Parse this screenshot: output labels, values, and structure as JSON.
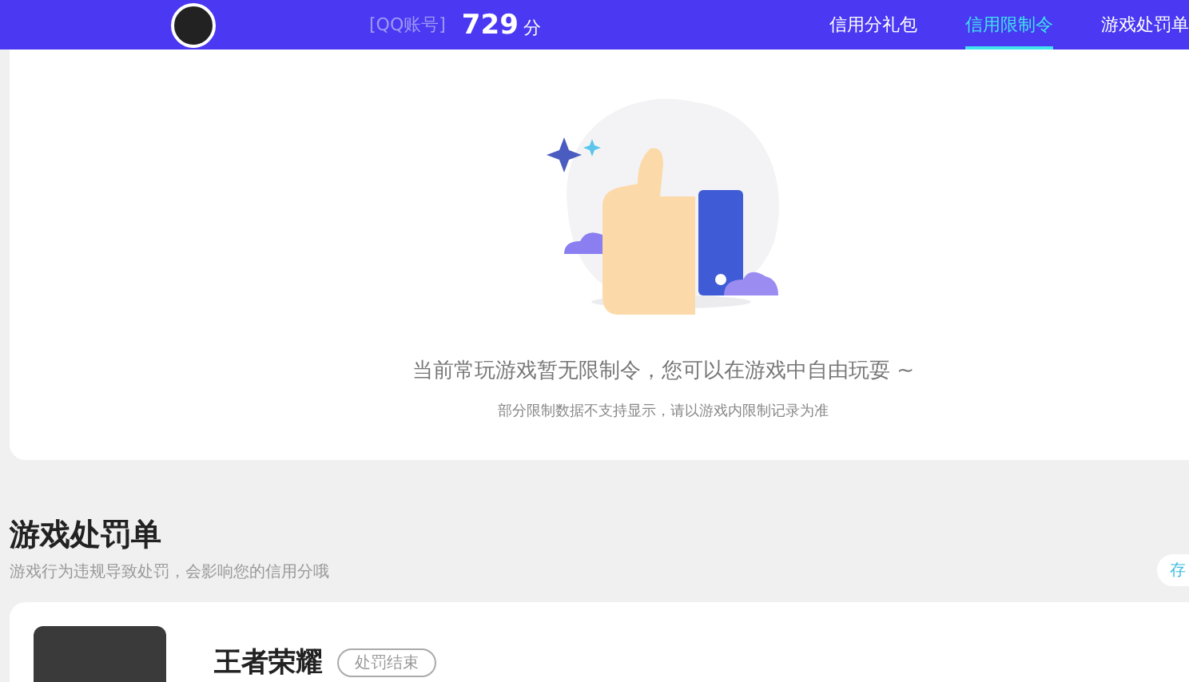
{
  "header": {
    "account_label": "[QQ账号]",
    "score": "729",
    "score_unit": "分",
    "tabs": [
      {
        "label": "信用分礼包",
        "selected": false
      },
      {
        "label": "信用限制令",
        "selected": true
      },
      {
        "label": "游戏处罚单",
        "selected": false
      }
    ]
  },
  "restriction_card": {
    "message": "当前常玩游戏暂无限制令，您可以在游戏中自由玩耍 ~",
    "note": "部分限制数据不支持显示，请以游戏内限制记录为准"
  },
  "penalty_section": {
    "title": "游戏处罚单",
    "subtitle": "游戏行为违规导致处罚，会影响您的信用分哦",
    "side_button": "存",
    "items": [
      {
        "game": "王者荣耀",
        "status": "处罚结束",
        "ended": true
      }
    ]
  }
}
